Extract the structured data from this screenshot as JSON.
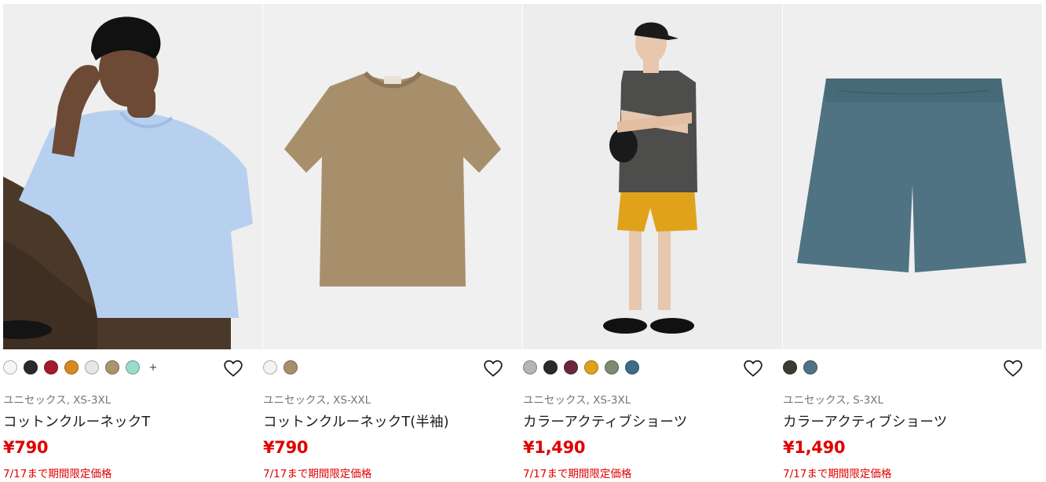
{
  "products": [
    {
      "gender_sizes": "ユニセックス, XS-3XL",
      "name": "コットンクルーネックT",
      "price": "¥790",
      "promo": "7/17まで期間限定価格",
      "more_colors": "+",
      "swatches": [
        "#f5f5f5",
        "#2a2a2a",
        "#a31c2b",
        "#d98a1e",
        "#e6e6e6",
        "#a9946e",
        "#98dccc"
      ],
      "image_subject": "model-light-blue-tee-brown-pants"
    },
    {
      "gender_sizes": "ユニセックス, XS-XXL",
      "name": "コットンクルーネックT(半袖)",
      "price": "¥790",
      "promo": "7/17まで期間限定価格",
      "swatches": [
        "#f3f3f3",
        "#a88f6c"
      ],
      "image_subject": "khaki-short-sleeve-tee"
    },
    {
      "gender_sizes": "ユニセックス, XS-3XL",
      "name": "カラーアクティブショーツ",
      "price": "¥1,490",
      "promo": "7/17まで期間限定価格",
      "swatches": [
        "#b5b5b5",
        "#2b2b2b",
        "#6b2739",
        "#e0a21a",
        "#7e8a71",
        "#3f6c86"
      ],
      "image_subject": "model-grey-tank-yellow-shorts"
    },
    {
      "gender_sizes": "ユニセックス, S-3XL",
      "name": "カラーアクティブショーツ",
      "price": "¥1,490",
      "promo": "7/17まで期間限定価格",
      "swatches": [
        "#3a3d32",
        "#4f7383"
      ],
      "image_subject": "blue-grey-shorts"
    }
  ],
  "colors": {
    "price": "#e00000",
    "tag": "#757575",
    "image_bg": "#efefef"
  }
}
